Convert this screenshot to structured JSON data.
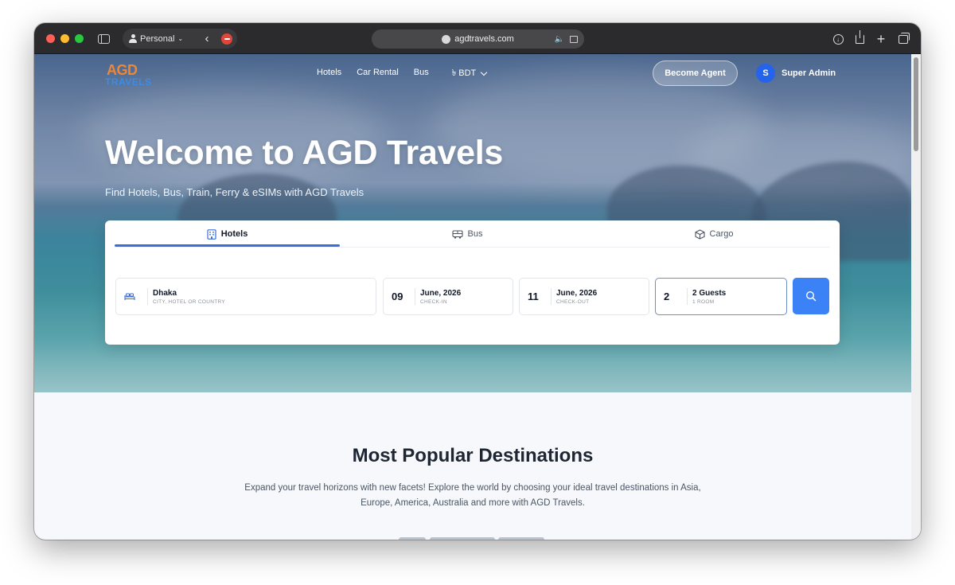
{
  "browser": {
    "profile_label": "Personal",
    "url": "agdtravels.com"
  },
  "site": {
    "logo": {
      "top": "AGD",
      "bottom": "TRAVELS"
    },
    "nav": [
      "Hotels",
      "Car Rental",
      "Bus"
    ],
    "currency": "৳ BDT",
    "agent_button": "Become Agent",
    "user": {
      "initial": "S",
      "name": "Super Admin"
    }
  },
  "hero": {
    "title": "Welcome to AGD Travels",
    "subtitle": "Find Hotels, Bus, Train, Ferry & eSIMs with AGD Travels"
  },
  "search": {
    "tabs": [
      "Hotels",
      "Bus",
      "Cargo"
    ],
    "active_tab": "Hotels",
    "destination": {
      "value": "Dhaka",
      "label": "CITY, HOTEL OR COUNTRY"
    },
    "check_in": {
      "day": "09",
      "month": "June, 2026",
      "label": "CHECK-IN"
    },
    "check_out": {
      "day": "11",
      "month": "June, 2026",
      "label": "CHECK-OUT"
    },
    "guests": {
      "count": "2",
      "value": "2 Guests",
      "label": "1 ROOM"
    }
  },
  "popular": {
    "title": "Most Popular Destinations",
    "description": "Expand your travel horizons with new facets! Explore the world by choosing your ideal travel destinations in Asia, Europe, America, Australia and more with AGD Travels."
  },
  "colors": {
    "primary": "#3b82f6",
    "tab_underline": "#3b6fd8",
    "logo_orange": "#f0862f",
    "logo_blue": "#3c8ce3"
  }
}
